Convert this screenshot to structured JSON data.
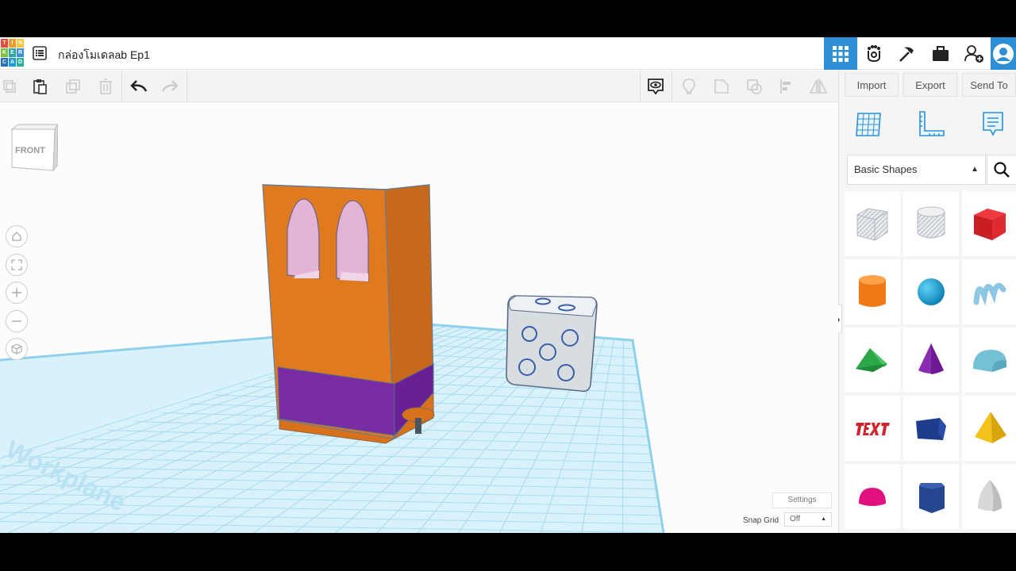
{
  "header": {
    "logo_letters": [
      "T",
      "I",
      "N",
      "K",
      "E",
      "R",
      "C",
      "A",
      "D"
    ],
    "title": "กล่องโมเดลab Ep1"
  },
  "toolbar": {
    "import_label": "Import",
    "export_label": "Export",
    "send_to_label": "Send To"
  },
  "sidebar": {
    "shape_category": "Basic Shapes"
  },
  "canvas": {
    "viewcube_label": "FRONT",
    "workplane_label": "Workplane",
    "settings_label": "Settings",
    "snap_grid_label": "Snap Grid",
    "snap_grid_value": "Off"
  },
  "colors": {
    "accent": "#2d8fd5",
    "toolbar_bg": "#f3f3f3",
    "grid": "#9ad6ec",
    "workplane": "#d8f0fa"
  }
}
